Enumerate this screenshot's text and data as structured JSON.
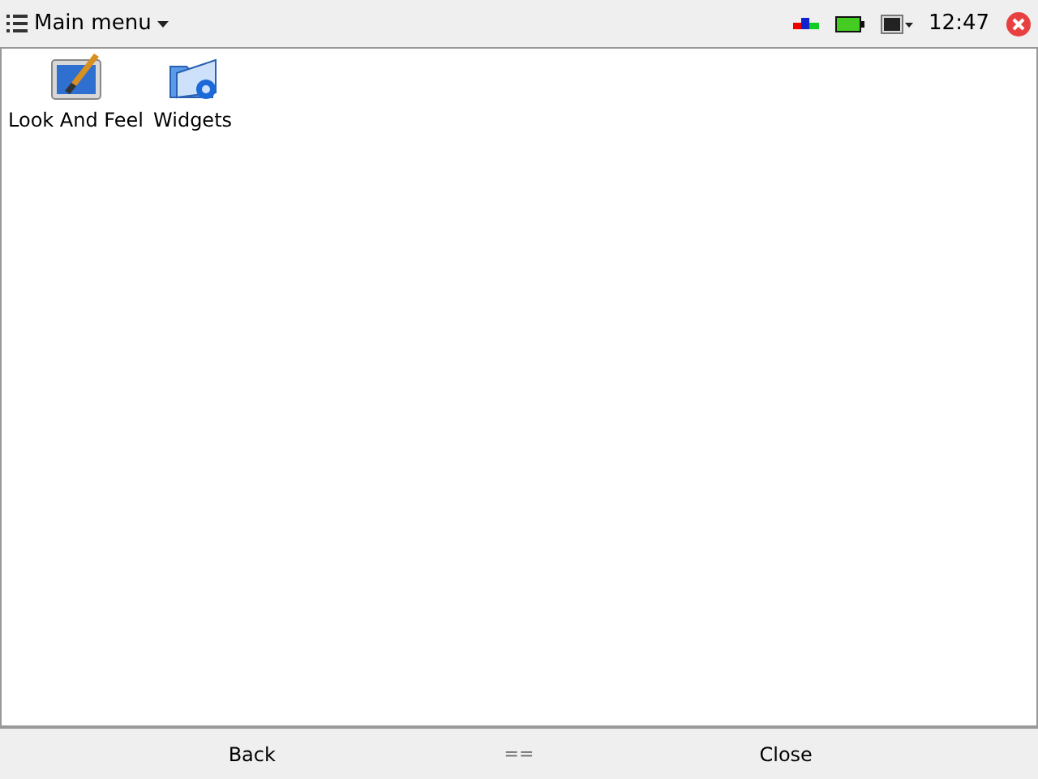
{
  "top_bar": {
    "menu_label": "Main menu",
    "clock": "12:47"
  },
  "launcher": {
    "items": [
      {
        "label": "Look And Feel"
      },
      {
        "label": "Widgets"
      }
    ]
  },
  "bottom_bar": {
    "left": "Back",
    "middle": "==",
    "right": "Close"
  }
}
